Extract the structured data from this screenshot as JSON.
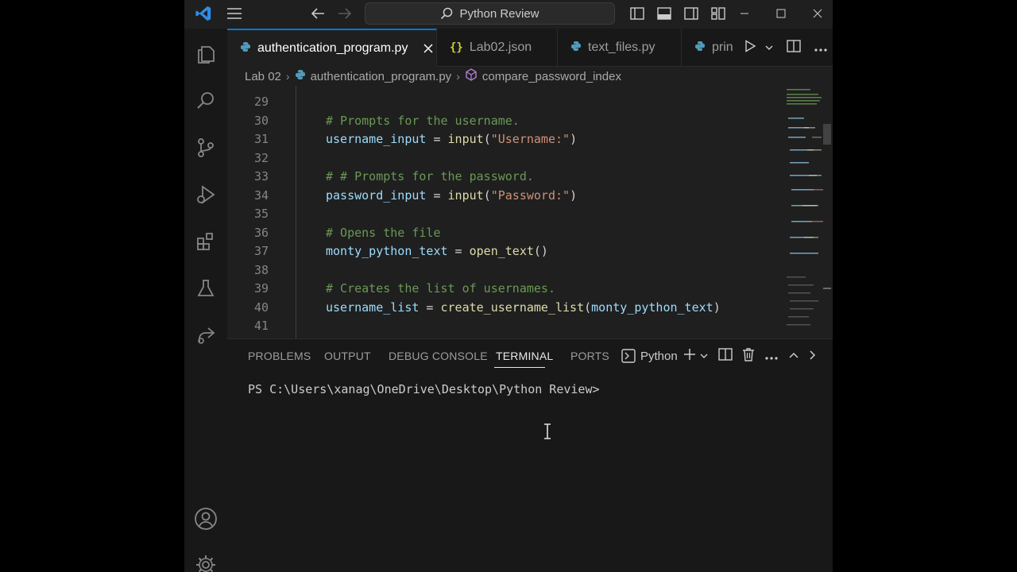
{
  "titlebar": {
    "search_label": "Python Review"
  },
  "tabs": [
    {
      "label": "authentication_program.py",
      "icon": "python-icon",
      "active": true
    },
    {
      "label": "Lab02.json",
      "icon": "json-icon",
      "active": false
    },
    {
      "label": "text_files.py",
      "icon": "python-icon",
      "active": false
    },
    {
      "label": "prin",
      "icon": "python-icon",
      "active": false
    }
  ],
  "breadcrumb": {
    "folder": "Lab 02",
    "file": "authentication_program.py",
    "symbol": "compare_password_index"
  },
  "editor": {
    "lines": [
      {
        "n": "29"
      },
      {
        "n": "30",
        "parts": [
          [
            "cm",
            "# Prompts for the username."
          ]
        ]
      },
      {
        "n": "31",
        "parts": [
          [
            "var",
            "username_input"
          ],
          [
            "op",
            " = "
          ],
          [
            "fn",
            "input"
          ],
          [
            "op",
            "("
          ],
          [
            "str",
            "\"Username:\""
          ],
          [
            "op",
            ")"
          ]
        ]
      },
      {
        "n": "32"
      },
      {
        "n": "33",
        "parts": [
          [
            "cm",
            "# # Prompts for the password."
          ]
        ]
      },
      {
        "n": "34",
        "parts": [
          [
            "var",
            "password_input"
          ],
          [
            "op",
            " = "
          ],
          [
            "fn",
            "input"
          ],
          [
            "op",
            "("
          ],
          [
            "str",
            "\"Password:\""
          ],
          [
            "op",
            ")"
          ]
        ]
      },
      {
        "n": "35"
      },
      {
        "n": "36",
        "parts": [
          [
            "cm",
            "# Opens the file"
          ]
        ]
      },
      {
        "n": "37",
        "parts": [
          [
            "var",
            "monty_python_text"
          ],
          [
            "op",
            " = "
          ],
          [
            "fn",
            "open_text"
          ],
          [
            "op",
            "()"
          ]
        ]
      },
      {
        "n": "38"
      },
      {
        "n": "39",
        "parts": [
          [
            "cm",
            "# Creates the list of usernames."
          ]
        ]
      },
      {
        "n": "40",
        "parts": [
          [
            "var",
            "username_list"
          ],
          [
            "op",
            " = "
          ],
          [
            "fn",
            "create_username_list"
          ],
          [
            "op",
            "("
          ],
          [
            "var",
            "monty_python_text"
          ],
          [
            "op",
            ")"
          ]
        ]
      },
      {
        "n": "41"
      }
    ]
  },
  "panel": {
    "tabs": [
      "PROBLEMS",
      "OUTPUT",
      "DEBUG CONSOLE",
      "TERMINAL",
      "PORTS"
    ],
    "active_tab": "TERMINAL",
    "terminal_name": "Python",
    "prompt": "PS C:\\Users\\xanag\\OneDrive\\Desktop\\Python Review>"
  },
  "colors": {
    "accent": "#0078d4",
    "comment": "#6a9955",
    "variable": "#9cdcfe",
    "function": "#dcdcaa",
    "string": "#ce9178"
  }
}
